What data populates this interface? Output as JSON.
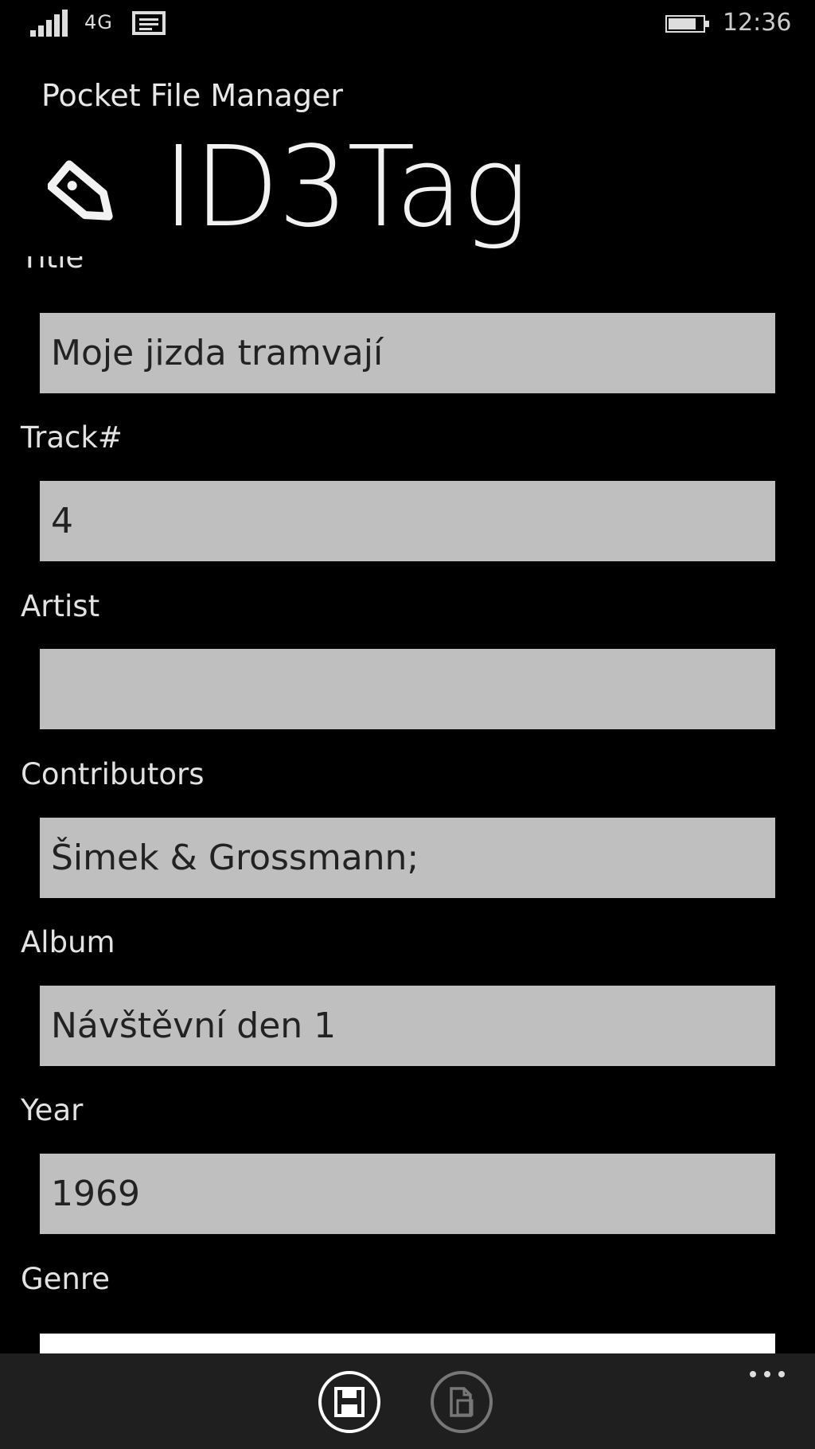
{
  "status_bar": {
    "network": "4G",
    "time": "12:36",
    "icons": [
      "signal-strength-icon",
      "message-icon",
      "battery-icon"
    ]
  },
  "header": {
    "app_name": "Pocket File Manager",
    "title": "ID3Tag",
    "icon": "tag-icon"
  },
  "fields": {
    "title": {
      "label": "Title",
      "value": "Moje jizda tramvají"
    },
    "track": {
      "label": "Track#",
      "value": "4"
    },
    "artist": {
      "label": "Artist",
      "value": ""
    },
    "contributors": {
      "label": "Contributors",
      "value": "Šimek & Grossmann;"
    },
    "album": {
      "label": "Album",
      "value": "Návštěvní den 1"
    },
    "year": {
      "label": "Year",
      "value": "1969"
    },
    "genre": {
      "label": "Genre",
      "value": ""
    }
  },
  "app_bar": {
    "buttons": [
      {
        "name": "save-button",
        "icon": "save-icon",
        "enabled": true
      },
      {
        "name": "copy-button",
        "icon": "document-icon",
        "enabled": false
      }
    ],
    "more": "more-options-icon"
  },
  "colors": {
    "background": "#000000",
    "field": "#bfbfbf",
    "field_text": "#222222",
    "app_bar": "#1f1f1f"
  }
}
